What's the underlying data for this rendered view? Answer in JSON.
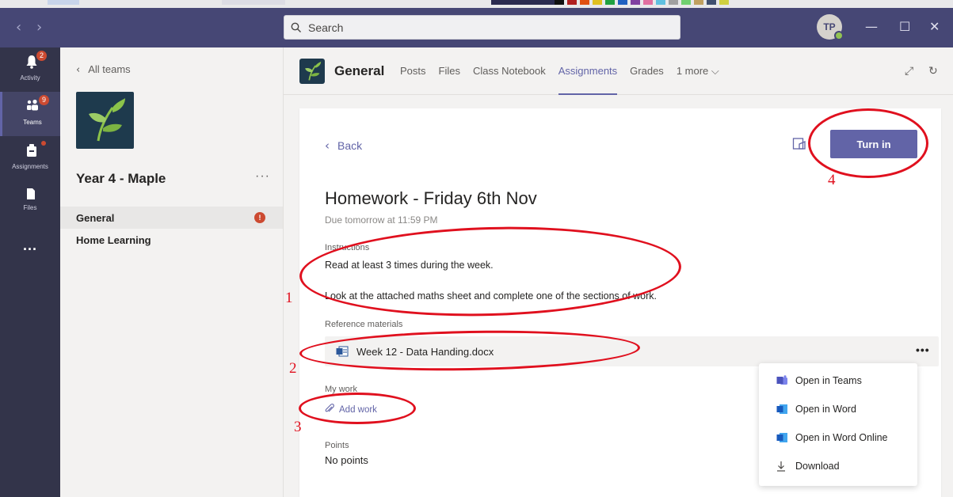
{
  "search": {
    "placeholder": "Search"
  },
  "user": {
    "initials": "TP"
  },
  "rail": {
    "items": [
      {
        "label": "Activity",
        "badge": "2"
      },
      {
        "label": "Teams",
        "badge": "9"
      },
      {
        "label": "Assignments"
      },
      {
        "label": "Files"
      }
    ],
    "more": "..."
  },
  "sidebar": {
    "back_label": "All teams",
    "team_name": "Year 4 - Maple",
    "more": "···",
    "channels": [
      {
        "label": "General",
        "badge": "!"
      },
      {
        "label": "Home Learning"
      }
    ]
  },
  "channel_header": {
    "title": "General",
    "tabs": [
      {
        "label": "Posts"
      },
      {
        "label": "Files"
      },
      {
        "label": "Class Notebook"
      },
      {
        "label": "Assignments"
      },
      {
        "label": "Grades"
      },
      {
        "label": "1 more ⌵"
      }
    ]
  },
  "assignment": {
    "back_label": "Back",
    "turn_in_label": "Turn in",
    "title": "Homework - Friday 6th Nov",
    "due": "Due tomorrow at 11:59 PM",
    "instructions_label": "Instructions",
    "instructions": [
      "Read at least 3 times during the week.",
      "Look at the attached maths sheet and complete one of the sections of work."
    ],
    "reference_label": "Reference materials",
    "reference_file": "Week 12 - Data Handing.docx",
    "reference_more": "•••",
    "my_work_label": "My work",
    "add_work_label": "Add work",
    "points_label": "Points",
    "points_value": "No points"
  },
  "file_menu": {
    "items": [
      {
        "label": "Open in Teams"
      },
      {
        "label": "Open in Word"
      },
      {
        "label": "Open in Word Online"
      },
      {
        "label": "Download"
      }
    ]
  },
  "annotations": [
    "1",
    "2",
    "3",
    "4"
  ],
  "colors": {
    "titlebar": "#464775",
    "rail": "#33344a",
    "accent": "#6264a7",
    "badge": "#cc4a31",
    "annotation": "#e0101e"
  }
}
